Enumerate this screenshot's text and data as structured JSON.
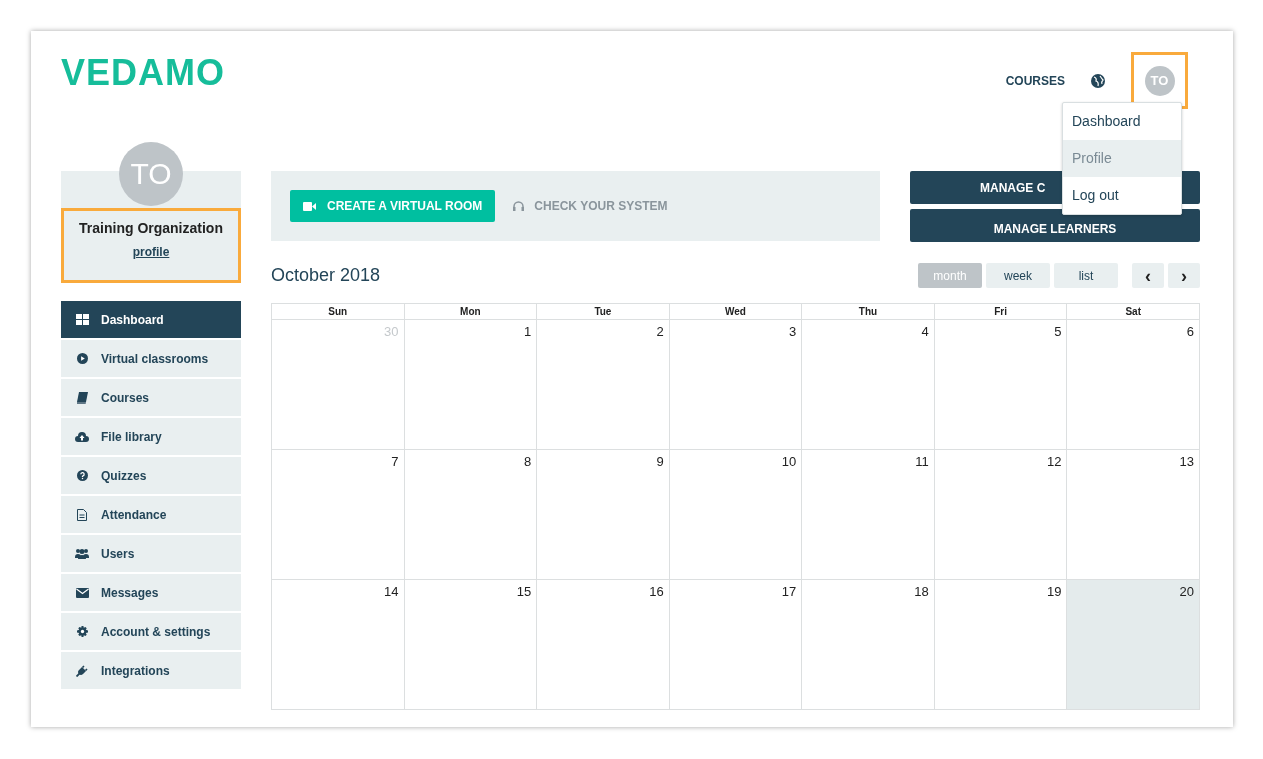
{
  "logo": {
    "text": "VEDAMO"
  },
  "top_nav": {
    "links": [
      {
        "label": "COURSES"
      }
    ],
    "avatar": {
      "initials": "TO"
    }
  },
  "user_menu": {
    "items": [
      {
        "label": "Dashboard",
        "selected": false
      },
      {
        "label": "Profile",
        "selected": true
      },
      {
        "label": "Log out",
        "selected": false
      }
    ]
  },
  "profile": {
    "initials": "TO",
    "name": "Training Organization",
    "link": "profile"
  },
  "sidebar": {
    "items": [
      {
        "label": "Dashboard",
        "selected": true
      },
      {
        "label": "Virtual classrooms",
        "selected": false
      },
      {
        "label": "Courses",
        "selected": false
      },
      {
        "label": "File library",
        "selected": false
      },
      {
        "label": "Quizzes",
        "selected": false
      },
      {
        "label": "Attendance",
        "selected": false
      },
      {
        "label": "Users",
        "selected": false
      },
      {
        "label": "Messages",
        "selected": false
      },
      {
        "label": "Account & settings",
        "selected": false
      },
      {
        "label": "Integrations",
        "selected": false
      }
    ]
  },
  "actions": {
    "create_button": "CREATE A VIRTUAL ROOM",
    "check_link": "CHECK YOUR SYSTEM",
    "manage_buttons": [
      "MANAGE C",
      "MANAGE LEARNERS"
    ]
  },
  "calendar": {
    "title": "October 2018",
    "views": [
      {
        "label": "month",
        "selected": true
      },
      {
        "label": "week",
        "selected": false
      },
      {
        "label": "list",
        "selected": false
      }
    ],
    "nav": [
      "‹",
      "›"
    ],
    "weekdays": [
      "Sun",
      "Mon",
      "Tue",
      "Wed",
      "Thu",
      "Fri",
      "Sat"
    ],
    "weeks": [
      [
        {
          "day": "30",
          "other_month": true,
          "today": false
        },
        {
          "day": "1",
          "other_month": false,
          "today": false
        },
        {
          "day": "2",
          "other_month": false,
          "today": false
        },
        {
          "day": "3",
          "other_month": false,
          "today": false
        },
        {
          "day": "4",
          "other_month": false,
          "today": false
        },
        {
          "day": "5",
          "other_month": false,
          "today": false
        },
        {
          "day": "6",
          "other_month": false,
          "today": false
        }
      ],
      [
        {
          "day": "7",
          "other_month": false,
          "today": false
        },
        {
          "day": "8",
          "other_month": false,
          "today": false
        },
        {
          "day": "9",
          "other_month": false,
          "today": false
        },
        {
          "day": "10",
          "other_month": false,
          "today": false
        },
        {
          "day": "11",
          "other_month": false,
          "today": false
        },
        {
          "day": "12",
          "other_month": false,
          "today": false
        },
        {
          "day": "13",
          "other_month": false,
          "today": false
        }
      ],
      [
        {
          "day": "14",
          "other_month": false,
          "today": false
        },
        {
          "day": "15",
          "other_month": false,
          "today": false
        },
        {
          "day": "16",
          "other_month": false,
          "today": false
        },
        {
          "day": "17",
          "other_month": false,
          "today": false
        },
        {
          "day": "18",
          "other_month": false,
          "today": false
        },
        {
          "day": "19",
          "other_month": false,
          "today": false
        },
        {
          "day": "20",
          "other_month": false,
          "today": true
        }
      ]
    ]
  }
}
